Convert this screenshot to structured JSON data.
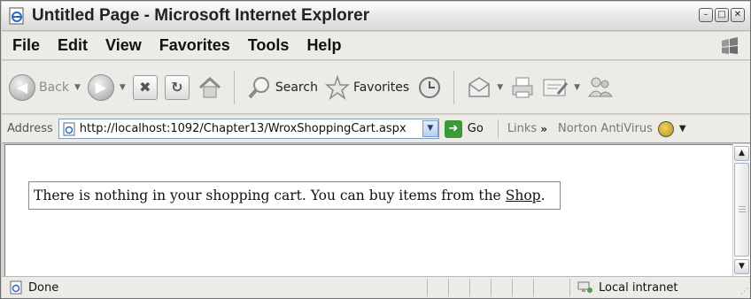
{
  "window": {
    "title": "Untitled Page - Microsoft Internet Explorer",
    "controls": {
      "minimize": "–",
      "restore": "□",
      "close": "✕"
    }
  },
  "menu": {
    "items": [
      "File",
      "Edit",
      "View",
      "Favorites",
      "Tools",
      "Help"
    ]
  },
  "toolbar": {
    "back_label": "Back",
    "search_label": "Search",
    "favorites_label": "Favorites",
    "icons": [
      "back-icon",
      "forward-icon",
      "stop-icon",
      "refresh-icon",
      "home-icon",
      "search-icon",
      "favorites-star-icon",
      "history-icon",
      "mail-icon",
      "print-icon",
      "edit-icon",
      "messenger-icon"
    ]
  },
  "address": {
    "label": "Address",
    "url": "http://localhost:1092/Chapter13/WroxShoppingCart.aspx",
    "go_label": "Go",
    "links_label": "Links",
    "links_chevron": "»",
    "addon_label": "Norton AntiVirus"
  },
  "content": {
    "message_prefix": "There is nothing in your shopping cart. You can buy items from the",
    "shop_link": "Shop",
    "message_suffix": "."
  },
  "status": {
    "text": "Done",
    "zone": "Local intranet"
  },
  "colors": {
    "chrome": "#ecebe6",
    "address_border": "#7f9db9",
    "go_green": "#3a9a3a"
  }
}
